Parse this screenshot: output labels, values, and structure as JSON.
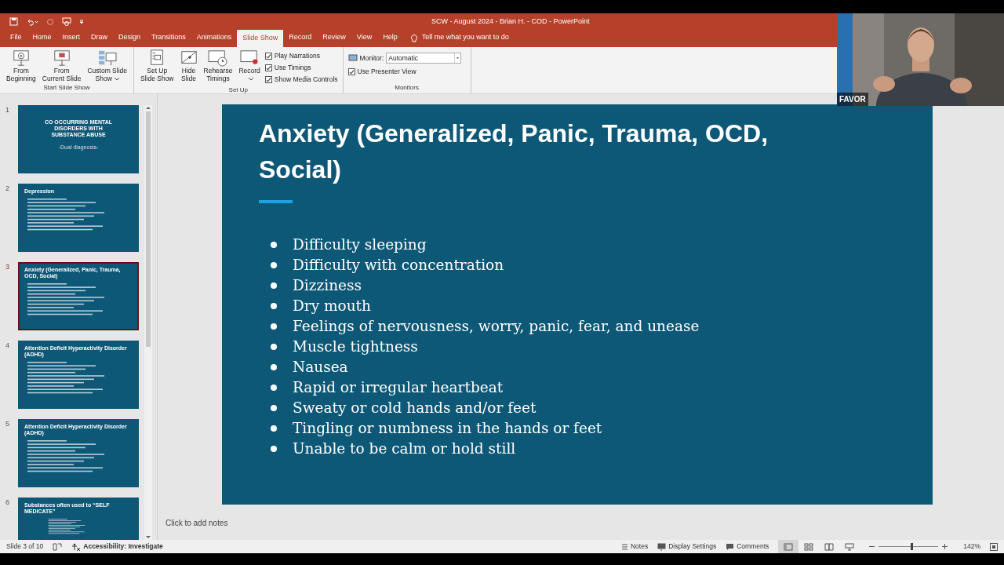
{
  "window": {
    "title": "SCW - August 2024 - Brian H. - COD  -  PowerPoint"
  },
  "tabs": [
    {
      "label": "File",
      "selected": false
    },
    {
      "label": "Home",
      "selected": false
    },
    {
      "label": "Insert",
      "selected": false
    },
    {
      "label": "Draw",
      "selected": false
    },
    {
      "label": "Design",
      "selected": false
    },
    {
      "label": "Transitions",
      "selected": false
    },
    {
      "label": "Animations",
      "selected": false
    },
    {
      "label": "Slide Show",
      "selected": true
    },
    {
      "label": "Record",
      "selected": false
    },
    {
      "label": "Review",
      "selected": false
    },
    {
      "label": "View",
      "selected": false
    },
    {
      "label": "Help",
      "selected": false
    }
  ],
  "tell_me": {
    "placeholder": "Tell me what you want to do"
  },
  "ribbon": [
    {
      "label": "Start Slide Show",
      "items": [
        {
          "kind": "button",
          "lines": [
            "From",
            "Beginning"
          ],
          "dropdown": false
        },
        {
          "kind": "button",
          "lines": [
            "From",
            "Current Slide"
          ],
          "dropdown": false
        },
        {
          "kind": "button",
          "lines": [
            "Custom Slide",
            "Show"
          ],
          "dropdown": true
        }
      ]
    },
    {
      "label": "Set Up",
      "items": [
        {
          "kind": "button",
          "lines": [
            "Set Up",
            "Slide Show"
          ],
          "dropdown": false
        },
        {
          "kind": "button",
          "lines": [
            "Hide",
            "Slide"
          ],
          "dropdown": false
        },
        {
          "kind": "button",
          "lines": [
            "Rehearse",
            "Timings"
          ],
          "dropdown": false
        },
        {
          "kind": "button",
          "lines": [
            "Record"
          ],
          "dropdown": true
        },
        {
          "kind": "checks",
          "checks": [
            {
              "label": "Play Narrations",
              "checked": true
            },
            {
              "label": "Use Timings",
              "checked": true
            },
            {
              "label": "Show Media Controls",
              "checked": true
            }
          ]
        }
      ]
    },
    {
      "label": "Monitors",
      "items": [
        {
          "kind": "monitor",
          "label": "Monitor:",
          "value": "Automatic",
          "checks": [
            {
              "label": "Use Presenter View",
              "checked": true
            }
          ]
        }
      ]
    }
  ],
  "thumbnails": [
    {
      "number": "1",
      "kind": "title",
      "title": "CO OCCURRING MENTAL DISORDERS WITH SUBSTANCE ABUSE",
      "subtitle": "-Dual diagnosis-",
      "selected": false
    },
    {
      "number": "2",
      "kind": "bullets",
      "title": "Depression",
      "selected": false
    },
    {
      "number": "3",
      "kind": "bullets",
      "title": "Anxiety (Generalized, Panic, Trauma, OCD, Social)",
      "selected": true
    },
    {
      "number": "4",
      "kind": "bullets",
      "title": "Attention Deficit Hyperactivity Disorder (ADHD)",
      "selected": false
    },
    {
      "number": "5",
      "kind": "bullets",
      "title": "Attention Deficit Hyperactivity Disorder (ADHD)",
      "selected": false
    },
    {
      "number": "6",
      "kind": "bullets",
      "title": "Substances often used to “SELF MEDICATE”",
      "selected": false
    }
  ],
  "slide": {
    "title": "Anxiety (Generalized, Panic, Trauma, OCD, Social)",
    "bullets": [
      "Difficulty sleeping",
      "Difficulty with concentration",
      "Dizziness",
      "Dry mouth",
      "Feelings of nervousness, worry, panic, fear, and unease",
      "Muscle tightness",
      "Nausea",
      "Rapid or irregular heartbeat",
      "Sweaty or cold hands and/or feet",
      "Tingling or numbness in the hands or feet",
      "Unable to be calm or hold still"
    ]
  },
  "notes": {
    "placeholder": "Click to add notes"
  },
  "status_bar": {
    "slide_counter": "Slide 3 of 10",
    "accessibility": "Accessibility: Investigate",
    "notes": "Notes",
    "display_settings": "Display Settings",
    "comments": "Comments",
    "views": [
      {
        "kind": "normal",
        "selected": true
      },
      {
        "kind": "sorter",
        "selected": false
      },
      {
        "kind": "reading",
        "selected": false
      },
      {
        "kind": "slideshow",
        "selected": false
      }
    ],
    "zoom": {
      "level": 0.53,
      "reading": "142%"
    }
  },
  "video": {
    "name": "FAVOR"
  }
}
